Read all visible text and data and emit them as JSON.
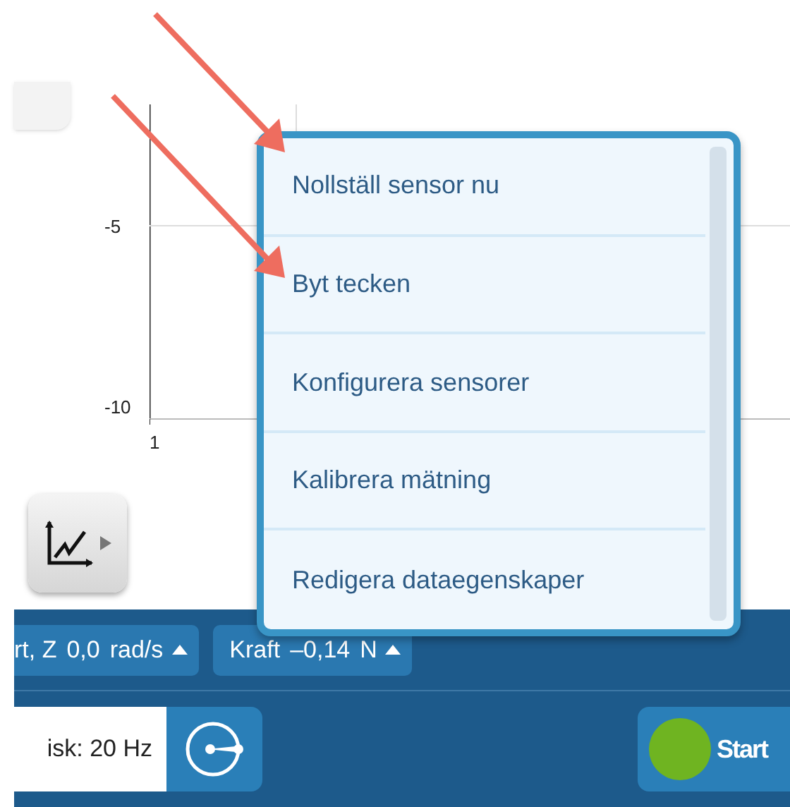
{
  "graph": {
    "y_ticks": [
      "-5",
      "-10"
    ],
    "x_ticks": [
      "1"
    ]
  },
  "context_menu": {
    "items": [
      {
        "label": "Nollställ sensor nu"
      },
      {
        "label": "Byt tecken"
      },
      {
        "label": "Konfigurera sensorer"
      },
      {
        "label": "Kalibrera mätning"
      },
      {
        "label": "Redigera dataegenskaper"
      }
    ]
  },
  "sensor_chips": [
    {
      "name": "rt, Z",
      "value": "0,0",
      "unit": "rad/s"
    },
    {
      "name": "Kraft",
      "value": "–0,14",
      "unit": "N"
    }
  ],
  "rate_field": {
    "value": "isk: 20 Hz"
  },
  "start_button": {
    "label": "Start"
  }
}
